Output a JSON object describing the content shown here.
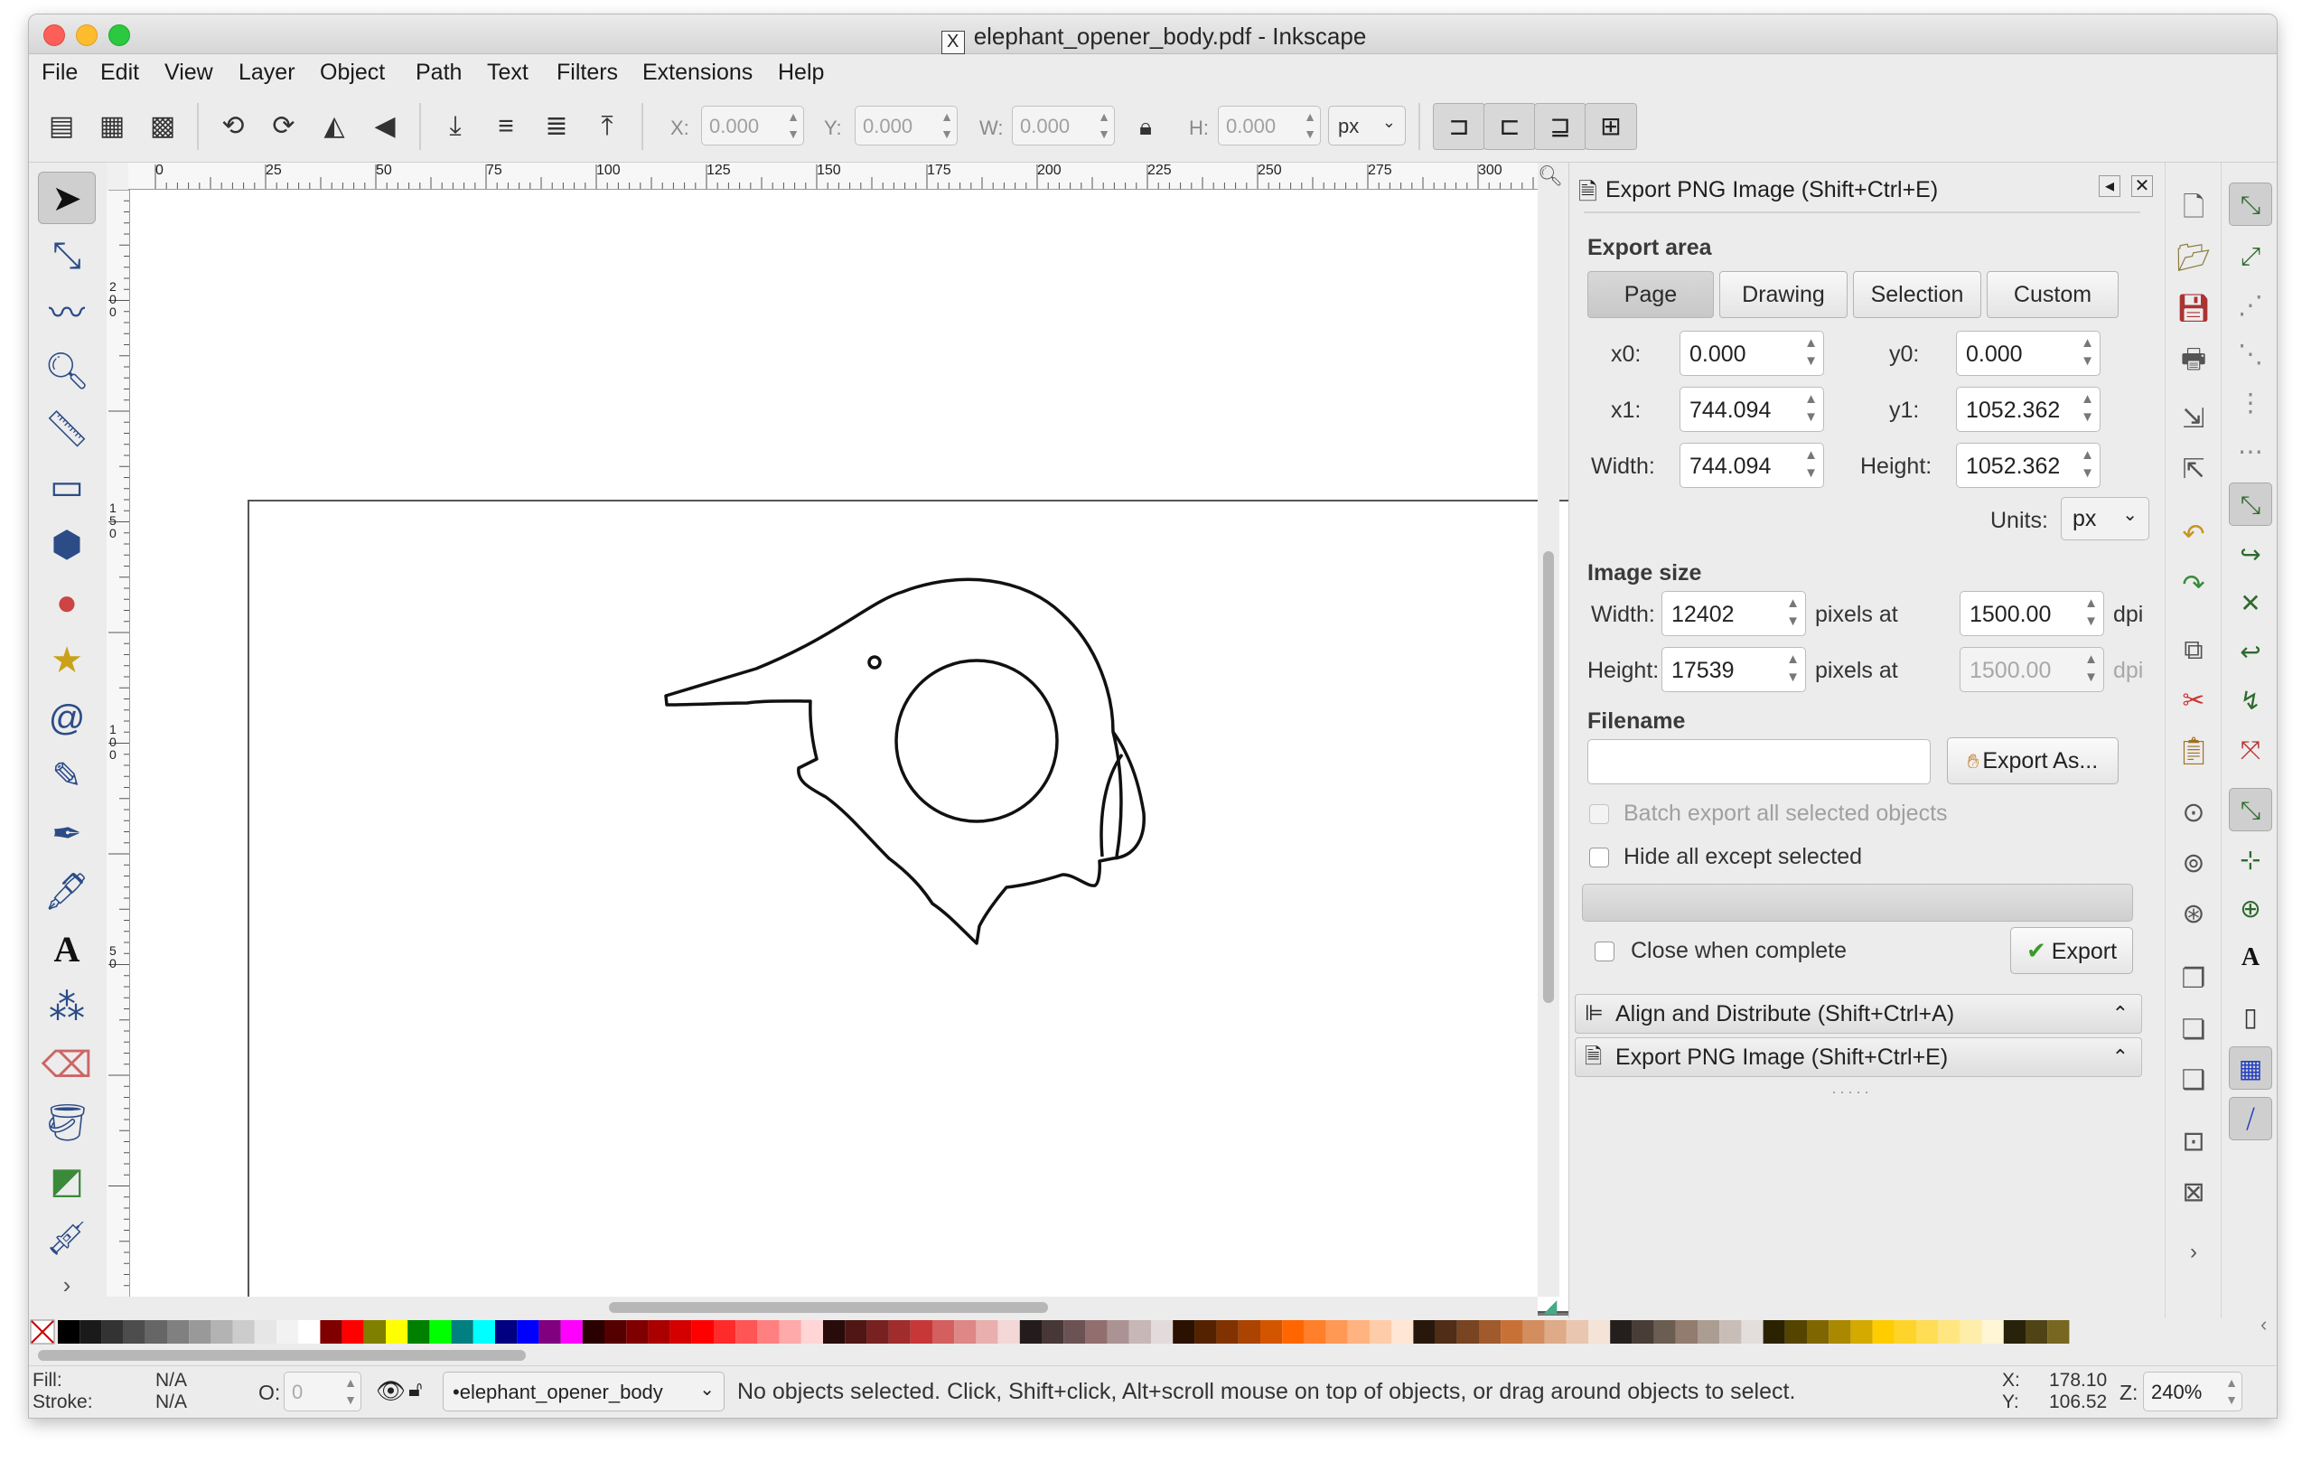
{
  "window": {
    "title": "elephant_opener_body.pdf - Inkscape",
    "app_icon": "X"
  },
  "menu": [
    "File",
    "Edit",
    "View",
    "Layer",
    "Object",
    "Path",
    "Text",
    "Filters",
    "Extensions",
    "Help"
  ],
  "toolbar": {
    "x_label": "X:",
    "x_value": "0.000",
    "y_label": "Y:",
    "y_value": "0.000",
    "w_label": "W:",
    "w_value": "0.000",
    "h_label": "H:",
    "h_value": "0.000",
    "unit": "px"
  },
  "ruler": {
    "top_ticks": [
      "0",
      "25",
      "50",
      "75",
      "100",
      "125",
      "150",
      "175",
      "200",
      "225",
      "250",
      "275",
      "300"
    ],
    "left_ticks": [
      "200",
      "150",
      "100",
      "50"
    ]
  },
  "export_dialog": {
    "title": "Export PNG Image (Shift+Ctrl+E)",
    "export_area_label": "Export area",
    "area_buttons": [
      "Page",
      "Drawing",
      "Selection",
      "Custom"
    ],
    "active_area": "Page",
    "x0_label": "x0:",
    "x0": "0.000",
    "y0_label": "y0:",
    "y0": "0.000",
    "x1_label": "x1:",
    "x1": "744.094",
    "y1_label": "y1:",
    "y1": "1052.362",
    "width_label": "Width:",
    "width": "744.094",
    "height_label": "Height:",
    "height": "1052.362",
    "units_label": "Units:",
    "units": "px",
    "image_size_label": "Image size",
    "img_width_label": "Width:",
    "img_width": "12402",
    "img_height_label": "Height:",
    "img_height": "17539",
    "pixels_at": "pixels at",
    "dpi_x": "1500.00",
    "dpi_y": "1500.00",
    "dpi_label": "dpi",
    "filename_label": "Filename",
    "filename_value": "",
    "export_as_button": "Export As...",
    "batch_export_label": "Batch export all selected objects",
    "hide_except_label": "Hide all except selected",
    "close_when_complete_label": "Close when complete",
    "export_button": "Export"
  },
  "docked_panels": [
    "Align and Distribute (Shift+Ctrl+A)",
    "Export PNG Image (Shift+Ctrl+E)"
  ],
  "status": {
    "fill_label": "Fill:",
    "fill_value": "N/A",
    "stroke_label": "Stroke:",
    "stroke_value": "N/A",
    "opacity_label": "O:",
    "opacity_value": "0",
    "layer": "•elephant_opener_body",
    "message": "No objects selected. Click, Shift+click, Alt+scroll mouse on top of objects, or drag around objects to select.",
    "cursor_x_label": "X:",
    "cursor_x": "178.10",
    "cursor_y_label": "Y:",
    "cursor_y": "106.52",
    "zoom_label": "Z:",
    "zoom": "240%"
  },
  "colors": {
    "accent": "#2b4c87",
    "canvas": "#ffffff",
    "ui_bg": "#ececec"
  }
}
